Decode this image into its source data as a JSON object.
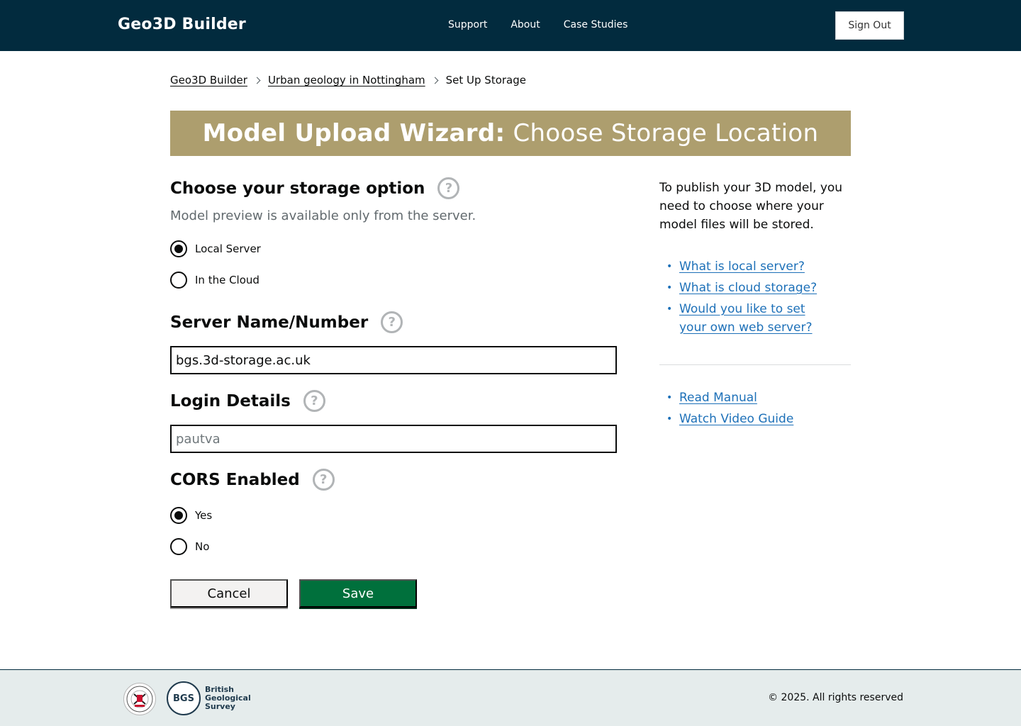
{
  "header": {
    "brand": "Geo3D Builder",
    "nav": [
      "Support",
      "About",
      "Case Studies"
    ],
    "sign_out": "Sign Out"
  },
  "breadcrumb": [
    "Geo3D Builder",
    "Urban geology in Nottingham",
    "Set Up Storage"
  ],
  "banner": {
    "bold": "Model Upload Wizard:",
    "rest": "Choose Storage Location"
  },
  "storage": {
    "title": "Choose your storage option",
    "hint": "Model preview is available only from the server.",
    "options": [
      {
        "label": "Local Server",
        "checked": true
      },
      {
        "label": "In the Cloud",
        "checked": false
      }
    ]
  },
  "server": {
    "title": "Server Name/Number",
    "value": "bgs.3d-storage.ac.uk"
  },
  "login": {
    "title": "Login Details",
    "placeholder": "pautva"
  },
  "cors": {
    "title": "CORS Enabled",
    "options": [
      {
        "label": "Yes",
        "checked": true
      },
      {
        "label": "No",
        "checked": false
      }
    ]
  },
  "buttons": {
    "cancel": "Cancel",
    "save": "Save"
  },
  "help_glyph": "?",
  "sidebar": {
    "intro": "To publish your 3D model, you need to choose where your model files will be stored.",
    "links": [
      "What is local server?",
      "What is cloud storage?",
      "Would you like to set your own web server?"
    ],
    "resources": [
      "Read Manual",
      "Watch Video Guide"
    ],
    "bullet": "•"
  },
  "footer": {
    "bgs_abbrev": "BGS",
    "bgs_name": [
      "British",
      "Geological",
      "Survey"
    ],
    "copyright": "© 2025. All rights reserved"
  },
  "colors": {
    "header_bg": "#022b3e",
    "banner_bg": "#ad9e6e",
    "save_bg": "#00703c",
    "link": "#1d70b8",
    "footer_bg": "#e5ecec"
  }
}
